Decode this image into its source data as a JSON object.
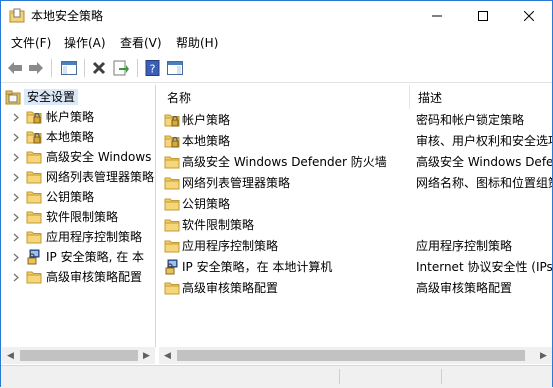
{
  "window": {
    "title": "本地安全策略"
  },
  "menu": [
    "文件(F)",
    "操作(A)",
    "查看(V)",
    "帮助(H)"
  ],
  "tree": {
    "root": "安全设置",
    "items": [
      {
        "label": "帐户策略",
        "icon": "folder-lock-icon"
      },
      {
        "label": "本地策略",
        "icon": "folder-lock-icon"
      },
      {
        "label": "高级安全 Windows",
        "icon": "folder-icon"
      },
      {
        "label": "网络列表管理器策略",
        "icon": "folder-icon"
      },
      {
        "label": "公钥策略",
        "icon": "folder-icon"
      },
      {
        "label": "软件限制策略",
        "icon": "folder-icon"
      },
      {
        "label": "应用程序控制策略",
        "icon": "folder-icon"
      },
      {
        "label": "IP 安全策略, 在 本",
        "icon": "ip-security-icon"
      },
      {
        "label": "高级审核策略配置",
        "icon": "folder-icon"
      }
    ]
  },
  "list": {
    "columns": [
      "名称",
      "描述"
    ],
    "rows": [
      {
        "name": "帐户策略",
        "desc": "密码和帐户锁定策略",
        "icon": "folder-lock-icon"
      },
      {
        "name": "本地策略",
        "desc": "审核、用户权利和安全选项",
        "icon": "folder-lock-icon"
      },
      {
        "name": "高级安全 Windows Defender 防火墙",
        "desc": "高级安全 Windows Defender",
        "icon": "folder-icon"
      },
      {
        "name": "网络列表管理器策略",
        "desc": "网络名称、图标和位置组策略",
        "icon": "folder-icon"
      },
      {
        "name": "公钥策略",
        "desc": "",
        "icon": "folder-icon"
      },
      {
        "name": "软件限制策略",
        "desc": "",
        "icon": "folder-icon"
      },
      {
        "name": "应用程序控制策略",
        "desc": "应用程序控制策略",
        "icon": "folder-icon"
      },
      {
        "name": "IP 安全策略，在 本地计算机",
        "desc": "Internet 协议安全性 (IPsec)",
        "icon": "ip-security-icon"
      },
      {
        "name": "高级审核策略配置",
        "desc": "高级审核策略配置",
        "icon": "folder-icon"
      }
    ]
  },
  "colors": {
    "folder": "#e8c25a",
    "selection": "#dbe8f7",
    "accent": "#2b79d6"
  }
}
